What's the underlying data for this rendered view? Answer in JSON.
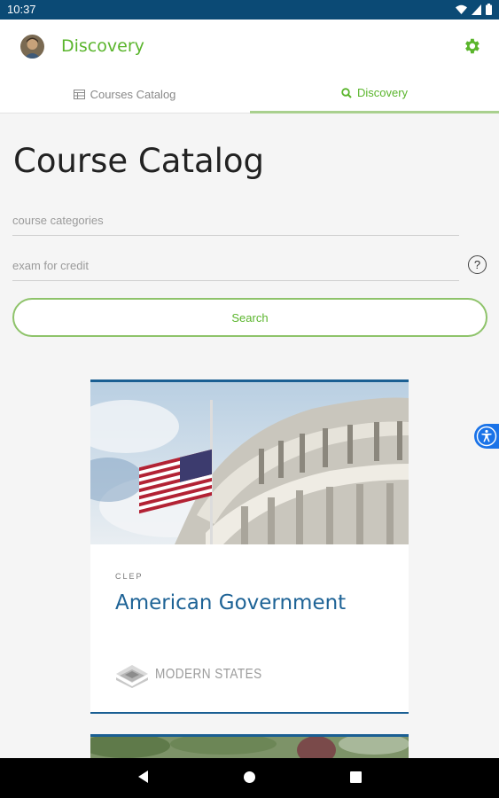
{
  "status_bar": {
    "time": "10:37"
  },
  "app_bar": {
    "title": "Discovery"
  },
  "tabs": [
    {
      "label": "Courses Catalog",
      "icon": "table-icon"
    },
    {
      "label": "Discovery",
      "icon": "search-icon"
    }
  ],
  "page": {
    "title": "Course Catalog"
  },
  "filters": {
    "categories_placeholder": "course categories",
    "exam_placeholder": "exam for credit",
    "help_symbol": "?"
  },
  "search": {
    "label": "Search"
  },
  "courses": [
    {
      "tag": "CLEP",
      "title": "American Government",
      "provider": "MODERN STATES"
    }
  ],
  "colors": {
    "accent": "#5ab52c",
    "status_bar": "#0b4a75",
    "link": "#1e6396",
    "card_border": "#1a5f93"
  }
}
